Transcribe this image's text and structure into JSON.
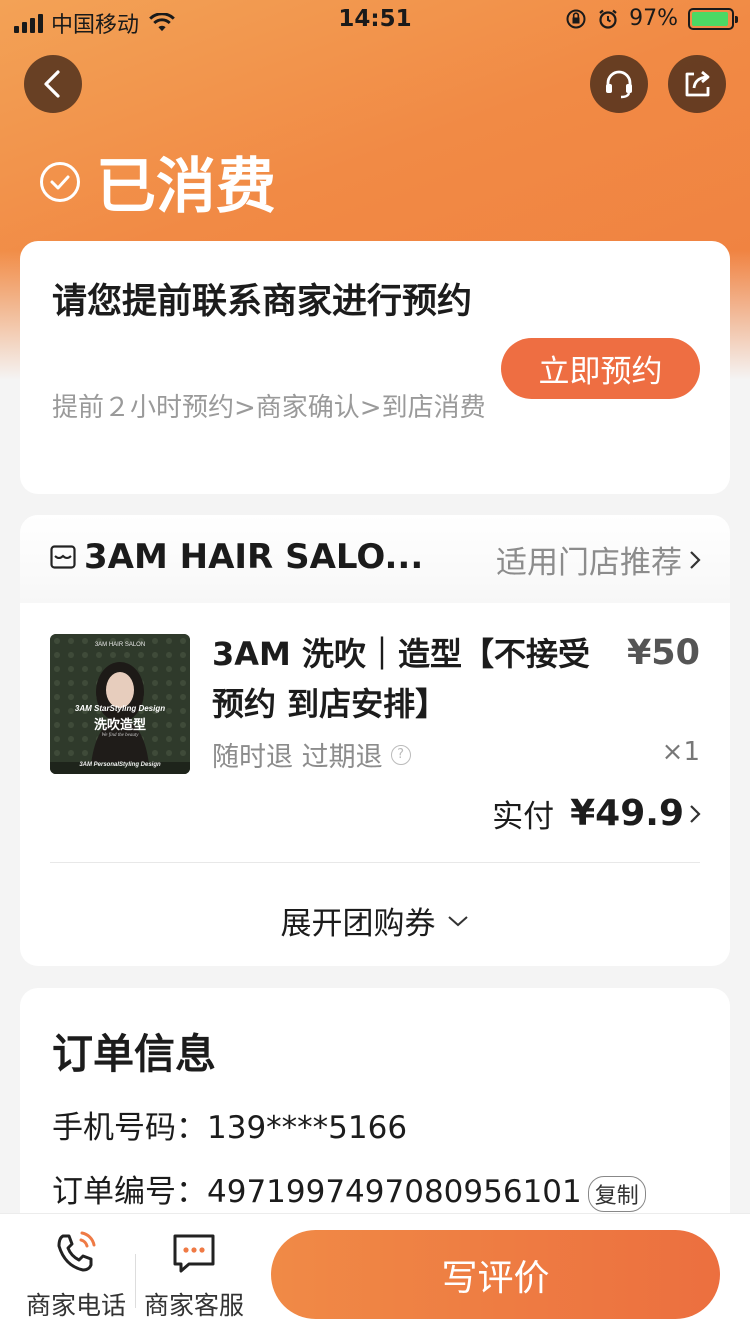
{
  "status_bar": {
    "carrier": "中国移动",
    "time": "14:51",
    "battery": "97%"
  },
  "header": {
    "status_title": "已消费"
  },
  "booking": {
    "title": "请您提前联系商家进行预约",
    "steps": "提前２小时预约>商家确认>到店消费",
    "button": "立即预约"
  },
  "shop": {
    "name": "3AM HAIR SALO...",
    "store_recommend": "适用门店推荐"
  },
  "product": {
    "thumb_header": "3AM HAIR SALON",
    "thumb_line1": "3AM StarStyling Design",
    "thumb_line2": "洗吹造型",
    "thumb_line3": "We find the beauty",
    "thumb_footer": "3AM PersonalStyling Design",
    "title": "3AM 洗吹｜造型【不接受预约 到店安排】",
    "price": "¥50",
    "refund": "随时退 过期退",
    "quantity": "×1",
    "paid_label": "实付",
    "paid_amount": "¥49.9",
    "expand": "展开团购券"
  },
  "order_info": {
    "title": "订单信息",
    "phone_label": "手机号码：",
    "phone": "139****5166",
    "order_label": "订单编号：",
    "order_no": "4971997497080956101",
    "copy": "复制"
  },
  "bottom": {
    "merchant_phone": "商家电话",
    "merchant_service": "商家客服",
    "review": "写评价"
  },
  "colors": {
    "accent": "#ee6e42",
    "hero": "#f18a45"
  }
}
